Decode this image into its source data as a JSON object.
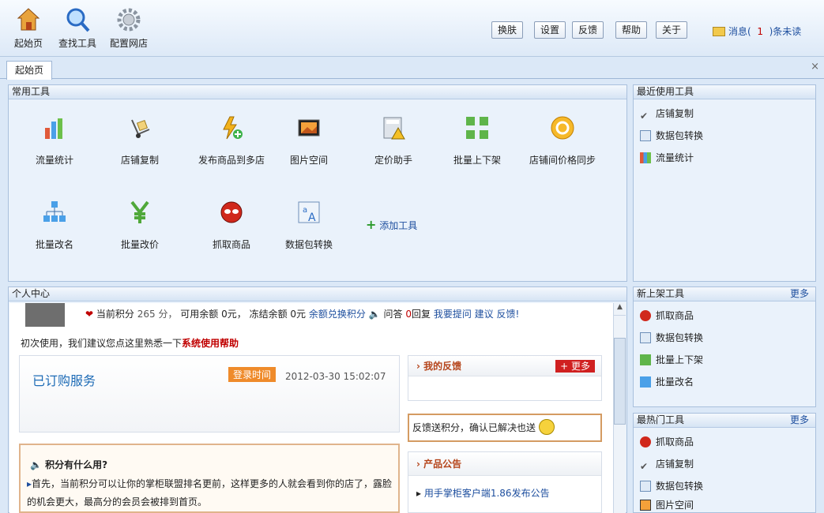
{
  "toolbar": {
    "left": [
      {
        "label": "起始页",
        "icon": "home-icon"
      },
      {
        "label": "查找工具",
        "icon": "search-icon"
      },
      {
        "label": "配置网店",
        "icon": "gear-icon"
      }
    ],
    "right": [
      "换肤",
      "设置",
      "反馈",
      "帮助",
      "关于"
    ],
    "msg_prefix": "消息(",
    "msg_count": "1",
    "msg_suffix": ")条未读"
  },
  "tab": {
    "label": "起始页",
    "close": "×"
  },
  "common": {
    "title": "常用工具",
    "tools": [
      "流量统计",
      "店铺复制",
      "发布商品到多店",
      "图片空间",
      "定价助手",
      "批量上下架",
      "店铺间价格同步",
      "批量改名",
      "批量改价",
      "抓取商品",
      "数据包转换"
    ],
    "add": "添加工具"
  },
  "recent": {
    "title": "最近使用工具",
    "items": [
      "店铺复制",
      "数据包转换",
      "流量统计"
    ]
  },
  "newtools": {
    "title": "新上架工具",
    "more": "更多",
    "items": [
      "抓取商品",
      "数据包转换",
      "批量上下架",
      "批量改名"
    ]
  },
  "hot": {
    "title": "最热门工具",
    "more": "更多",
    "items": [
      "抓取商品",
      "店铺复制",
      "数据包转换",
      "图片空间"
    ]
  },
  "personal": {
    "title": "个人中心",
    "points_label": "当前积分",
    "points": "265 分，",
    "balance": "可用余额 0元，",
    "frozen": "冻结余额 0元",
    "exchange": "余额兑换积分",
    "qa": "问答",
    "reply_count": "0",
    "reply": "回复",
    "ask": "我要提问",
    "suggest": "建议",
    "feedback_link": "反馈!",
    "tip": "初次使用，我们建议您点这里熟悉一下",
    "help_link": "系统使用帮助",
    "ordered": "已订购服务",
    "login_time_label": "登录时间",
    "login_time": "2012-03-30 15:02:07",
    "my_feedback": "我的反馈",
    "more_btn": "更多",
    "fb_tip": "反馈送积分，确认已解决也送",
    "points_q": "积分有什么用?",
    "points_a": "首先，当前积分可以让你的掌柜联盟排名更前，这样更多的人就会看到你的店了，露脸的机会更大，最高分的会员会被排到首页。",
    "notice": "产品公告",
    "notice_item": "用手掌柜客户端1.86发布公告"
  }
}
